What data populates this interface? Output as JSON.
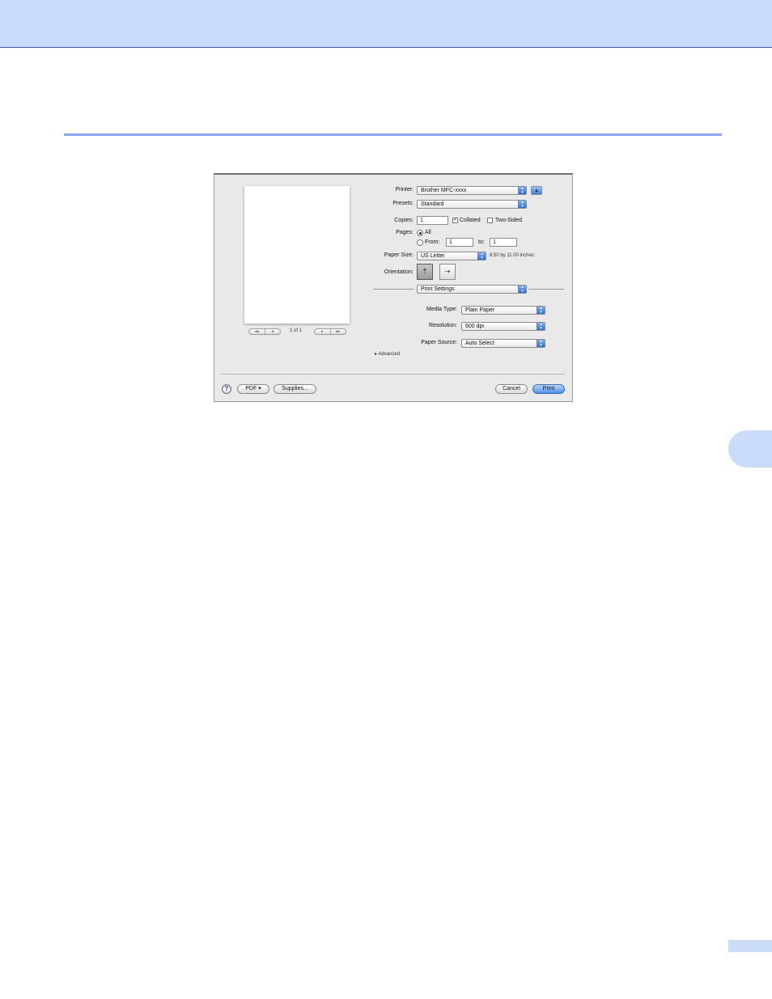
{
  "dialog": {
    "pager": {
      "first_prev": [
        "◂◂",
        "◂"
      ],
      "page_label": "1 of 1",
      "next_last": [
        "▸",
        "▸▸"
      ]
    },
    "printer": {
      "label": "Printer:",
      "value": "Brother MFC-xxxx",
      "expand_glyph": "▴"
    },
    "presets": {
      "label": "Presets:",
      "value": "Standard"
    },
    "copies": {
      "label": "Copies:",
      "value": "1",
      "collated_label": "Collated",
      "collated_checked": true,
      "two_sided_label": "Two-Sided",
      "two_sided_checked": false
    },
    "pages": {
      "label": "Pages:",
      "all_label": "All",
      "from_label": "From:",
      "from_value": "1",
      "to_label": "to:",
      "to_value": "1",
      "selected": "All"
    },
    "paper_size": {
      "label": "Paper Size:",
      "value": "US Letter",
      "dimensions": "8.50 by 11.00 inches"
    },
    "orientation": {
      "label": "Orientation:",
      "selected": "portrait"
    },
    "panel": {
      "value": "Print Settings"
    },
    "media_type": {
      "label": "Media Type:",
      "value": "Plain Paper"
    },
    "resolution": {
      "label": "Resolution:",
      "value": "600 dpi"
    },
    "paper_source": {
      "label": "Paper Source:",
      "value": "Auto Select"
    },
    "advanced": {
      "label": "Advanced"
    },
    "footer": {
      "help": "?",
      "pdf_label": "PDF ▾",
      "supplies_label": "Supplies...",
      "cancel_label": "Cancel",
      "print_label": "Print"
    }
  },
  "colors": {
    "band": "#cbdcfb",
    "rule": "#8aa7f0",
    "accent": "#4f8fe7"
  }
}
